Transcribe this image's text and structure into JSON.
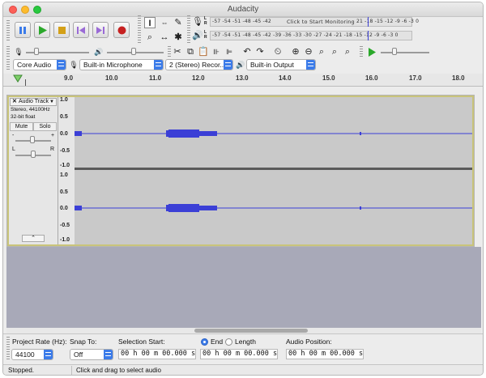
{
  "window": {
    "title": "Audacity"
  },
  "colors": {
    "waveform": "#3b3fd6",
    "track_bg": "#c9c9c9",
    "empty_area": "#a8a9b8",
    "play_green": "#2aa82a",
    "record_red": "#c62020",
    "accent_blue": "#3b7be9",
    "selection_border": "#c9c47a"
  },
  "toolbar": {
    "transport": {
      "pause_icon": "pause-icon",
      "play_icon": "play-icon",
      "stop_icon": "stop-icon",
      "skip_start_icon": "skip-to-start-icon",
      "skip_end_icon": "skip-to-end-icon",
      "record_icon": "record-icon"
    },
    "tools": [
      "selection-tool-icon",
      "envelope-tool-icon",
      "draw-tool-icon",
      "zoom-tool-icon",
      "timeshift-tool-icon",
      "multi-tool-icon"
    ],
    "meter_record_ticks": "-57 -54 -51 -48 -45 -42",
    "meter_record_tail": "21 -18 -15 -12 -9 -6 -3 0",
    "meter_monitor_label": "Click to Start Monitoring",
    "meter_play_ticks": "-57 -54 -51 -48 -45 -42 -39 -36 -33 -30 -27 -24 -21 -18 -15 -12 -9 -6 -3 0",
    "meter_l": "L",
    "meter_r": "R"
  },
  "devices": {
    "host": "Core Audio",
    "input": "Built-in Microphone",
    "channels": "2 (Stereo) Recor...",
    "output": "Built-in Output"
  },
  "ruler": {
    "ticks": [
      "9.0",
      "10.0",
      "11.0",
      "12.0",
      "13.0",
      "14.0",
      "15.0",
      "16.0",
      "17.0",
      "18.0"
    ]
  },
  "track": {
    "name": "Audio Track",
    "format": "Stereo, 44100Hz",
    "bits": "32-bit float",
    "mute": "Mute",
    "solo": "Solo",
    "gain_minus": "-",
    "gain_plus": "+",
    "pan_left": "L",
    "pan_right": "R",
    "scale": [
      "1.0",
      "0.5",
      "0.0",
      "-0.5",
      "-1.0"
    ]
  },
  "selection_toolbar": {
    "project_rate_label": "Project Rate (Hz):",
    "project_rate_value": "44100",
    "snap_to_label": "Snap To:",
    "snap_to_value": "Off",
    "selection_start_label": "Selection Start:",
    "end_label": "End",
    "length_label": "Length",
    "audio_position_label": "Audio Position:",
    "selection_start_value": "00 h 00 m 00.000 s",
    "end_value": "00 h 00 m 00.000 s",
    "audio_position_value": "00 h 00 m 00.000 s"
  },
  "status": {
    "state": "Stopped.",
    "hint": "Click and drag to select audio"
  }
}
